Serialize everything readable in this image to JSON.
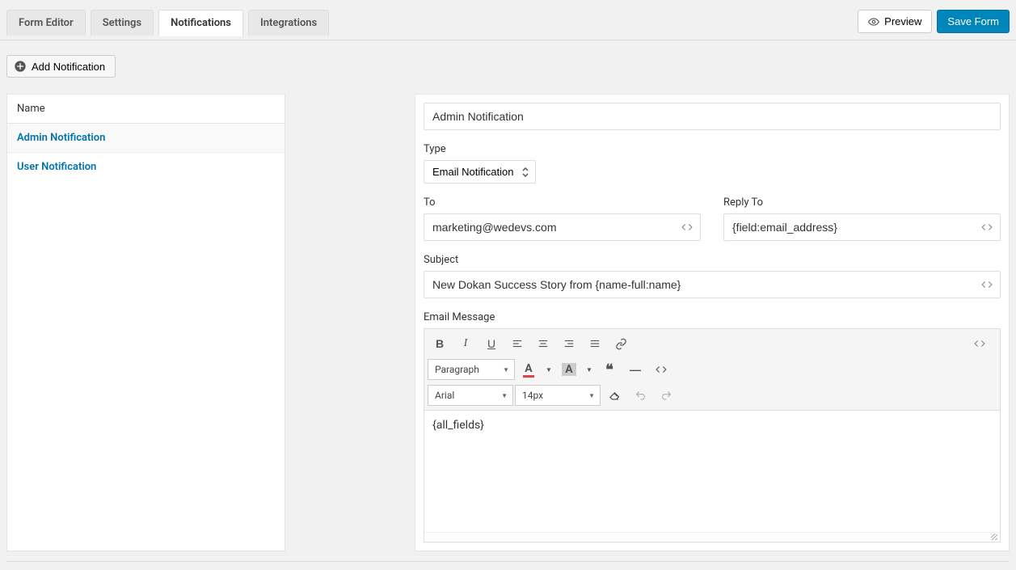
{
  "tabs": {
    "form_editor": "Form Editor",
    "settings": "Settings",
    "notifications": "Notifications",
    "integrations": "Integrations"
  },
  "actions": {
    "preview": "Preview",
    "save": "Save Form"
  },
  "add_notification": "Add Notification",
  "sidebar": {
    "header": "Name",
    "items": [
      "Admin Notification",
      "User Notification"
    ]
  },
  "form": {
    "title_value": "Admin Notification",
    "type_label": "Type",
    "type_value": "Email Notification",
    "to_label": "To",
    "to_value": "marketing@wedevs.com",
    "replyto_label": "Reply To",
    "replyto_value": "{field:email_address}",
    "subject_label": "Subject",
    "subject_value": "New Dokan Success Story from {name-full:name}",
    "message_label": "Email Message",
    "message_value": "{all_fields}"
  },
  "editor": {
    "format": "Paragraph",
    "font": "Arial",
    "size": "14px"
  }
}
